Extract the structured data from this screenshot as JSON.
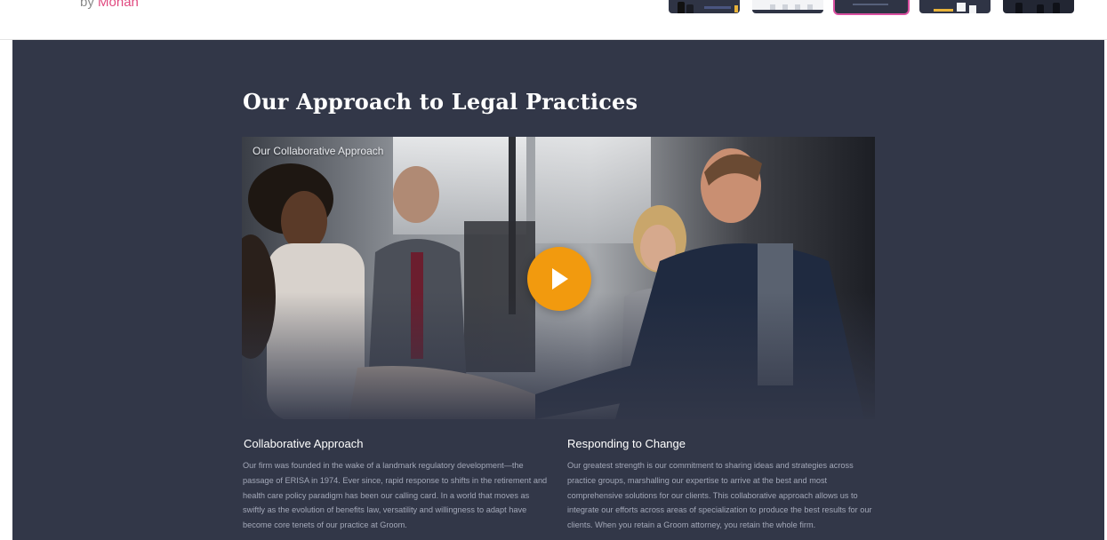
{
  "header": {
    "byline_prefix": "by",
    "byline_author": "Mohan",
    "thumbnails": [
      {
        "label": "thumbnail-1",
        "active": false
      },
      {
        "label": "thumbnail-2",
        "active": false
      },
      {
        "label": "thumbnail-3",
        "active": true
      },
      {
        "label": "thumbnail-4",
        "active": false
      },
      {
        "label": "thumbnail-5",
        "active": false
      }
    ]
  },
  "section": {
    "title": "Our Approach to Legal Practices",
    "video": {
      "caption": "Our Collaborative Approach",
      "play_icon": "play-icon"
    },
    "columns": [
      {
        "heading": "Collaborative Approach",
        "body": "Our firm was founded in the wake of a landmark regulatory development—the passage of ERISA in 1974. Ever since, rapid response to shifts in the retirement and health care policy paradigm has been our calling card. In a world that moves as swiftly as the evolution of benefits law, versatility and willingness to adapt have become core tenets of our practice at Groom."
      },
      {
        "heading": "Responding to Change",
        "body": "Our greatest strength is our commitment to sharing ideas and strategies across practice groups, marshalling our expertise to arrive at the best and most comprehensive solutions for our clients. This collaborative approach allows us to integrate our efforts across areas of specialization to produce the best results for our clients. When you retain a Groom attorney, you retain the whole firm."
      }
    ]
  },
  "colors": {
    "section_bg": "#323748",
    "accent_play": "#f29a0e",
    "author_link": "#e0497f",
    "active_thumb_border": "#d94fa0"
  }
}
